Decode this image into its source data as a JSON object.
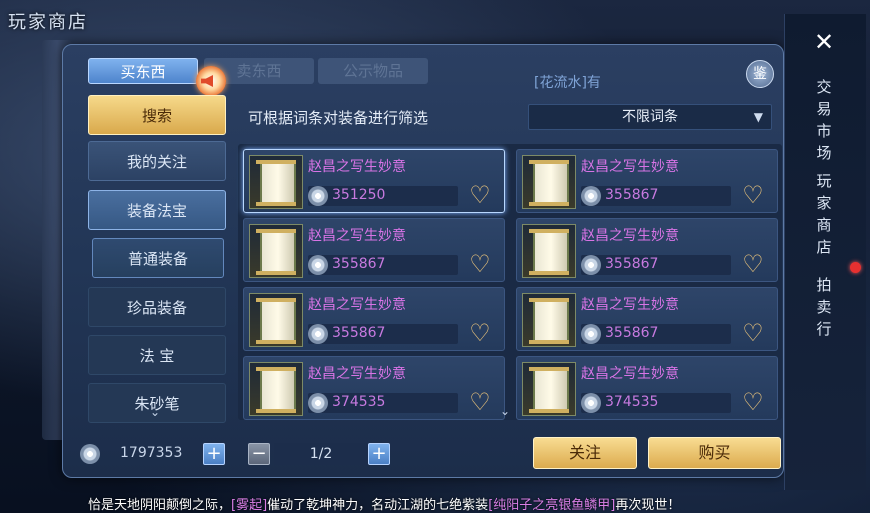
{
  "window": {
    "title": "玩家商店"
  },
  "tabs": [
    {
      "label": "买东西",
      "active": true
    },
    {
      "label": "卖东西",
      "active": false
    },
    {
      "label": "公示物品",
      "active": false
    }
  ],
  "marquee": "[花流水]有",
  "appraise_label": "鉴",
  "menu": {
    "search": "搜索",
    "follow": "我的关注",
    "equipment": "装备法宝",
    "normal_equipment": "普通装备",
    "rare_equipment": "珍品装备",
    "treasure": "法 宝",
    "cinnabar_pen": "朱砂笔"
  },
  "filter": {
    "label": "可根据词条对装备进行筛选",
    "selected": "不限词条"
  },
  "items": [
    {
      "name": "赵昌之写生妙意",
      "price": "351250"
    },
    {
      "name": "赵昌之写生妙意",
      "price": "355867"
    },
    {
      "name": "赵昌之写生妙意",
      "price": "355867"
    },
    {
      "name": "赵昌之写生妙意",
      "price": "355867"
    },
    {
      "name": "赵昌之写生妙意",
      "price": "355867"
    },
    {
      "name": "赵昌之写生妙意",
      "price": "355867"
    },
    {
      "name": "赵昌之写生妙意",
      "price": "374535"
    },
    {
      "name": "赵昌之写生妙意",
      "price": "374535"
    }
  ],
  "wallet": {
    "balance": "1797353",
    "plus": "+"
  },
  "pagination": {
    "minus": "−",
    "page": "1/2",
    "plus": "+"
  },
  "actions": {
    "follow": "关注",
    "buy": "购买"
  },
  "right_nav": {
    "close": "✕",
    "items": [
      "交易市场",
      "玩家商店",
      "拍卖行"
    ]
  },
  "ticker": {
    "part1": "恰是天地阴阳颠倒之际，",
    "tag1": "[雾起]",
    "part2": "催动了乾坤神力，名动江湖的七绝紫装",
    "tag2": "[纯阳子之亮银鱼鳞甲]",
    "part3": "再次现世！"
  },
  "colors": {
    "accent_gold": "#dcab4e",
    "item_purple": "#d874e6",
    "tab_blue": "#4e84cc"
  }
}
